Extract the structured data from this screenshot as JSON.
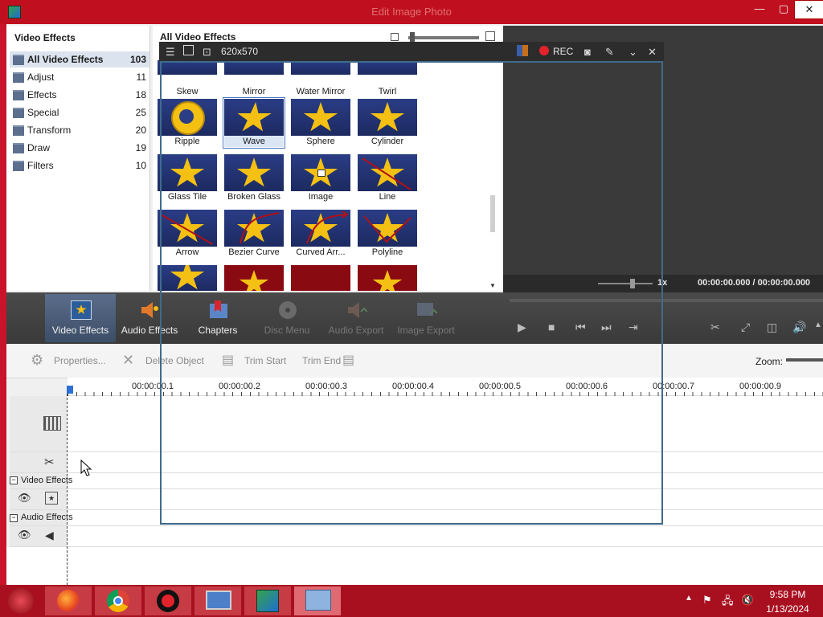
{
  "window": {
    "title": "Edit Image Photo"
  },
  "left_panel": {
    "title": "Video Effects",
    "categories": [
      {
        "label": "All Video Effects",
        "count": "103"
      },
      {
        "label": "Adjust",
        "count": "11"
      },
      {
        "label": "Effects",
        "count": "18"
      },
      {
        "label": "Special",
        "count": "25"
      },
      {
        "label": "Transform",
        "count": "20"
      },
      {
        "label": "Draw",
        "count": "19"
      },
      {
        "label": "Filters",
        "count": "10"
      }
    ]
  },
  "grid": {
    "title": "All Video Effects",
    "effects": [
      "Skew",
      "Mirror",
      "Water Mirror",
      "Twirl",
      "Ripple",
      "Wave",
      "Sphere",
      "Cylinder",
      "Glass Tile",
      "Broken Glass",
      "Image",
      "Line",
      "Arrow",
      "Bezier Curve",
      "Curved Arr...",
      "Polyline"
    ],
    "selected": "Wave"
  },
  "recorder": {
    "size": "620x570",
    "rec_label": "REC",
    "icons": [
      "menu-icon",
      "region-icon",
      "zoom-region-icon",
      "palette-icon",
      "record-icon",
      "camera-icon",
      "pen-icon",
      "collapse-icon",
      "close-icon"
    ]
  },
  "preview": {
    "speed": "1x",
    "timecode": "00:00:00.000 / 00:00:00.000"
  },
  "tabs": [
    {
      "label": "Video Effects",
      "icon": "video-effects-icon",
      "active": true
    },
    {
      "label": "Audio Effects",
      "icon": "audio-effects-icon"
    },
    {
      "label": "Chapters",
      "icon": "chapters-icon"
    },
    {
      "label": "Disc Menu",
      "icon": "disc-menu-icon",
      "disabled": true
    },
    {
      "label": "Audio Export",
      "icon": "audio-export-icon",
      "disabled": true
    },
    {
      "label": "Image Export",
      "icon": "image-export-icon",
      "disabled": true
    }
  ],
  "timeline_toolbar": {
    "properties": "Properties...",
    "delete": "Delete Object",
    "trim_start": "Trim Start",
    "trim_end": "Trim End",
    "zoom_label": "Zoom:"
  },
  "ruler": [
    "00:00:00.1",
    "00:00:00.2",
    "00:00:00.3",
    "00:00:00.4",
    "00:00:00.5",
    "00:00:00.6",
    "00:00:00.7",
    "00:00:00.9"
  ],
  "tracks": {
    "video_effects": "Video Effects",
    "audio_effects": "Audio Effects"
  },
  "taskbar": {
    "items": [
      "start-icon",
      "firefox-icon",
      "chrome-icon",
      "recorder-icon",
      "network-computer-icon",
      "photo-editor-icon",
      "control-panel-icon"
    ],
    "time": "9:58 PM",
    "date": "1/13/2024"
  },
  "colors": {
    "desktop": "#c8142a",
    "accent": "#2d6fd6",
    "rec": "#e3232b",
    "star": "#f3c013"
  }
}
